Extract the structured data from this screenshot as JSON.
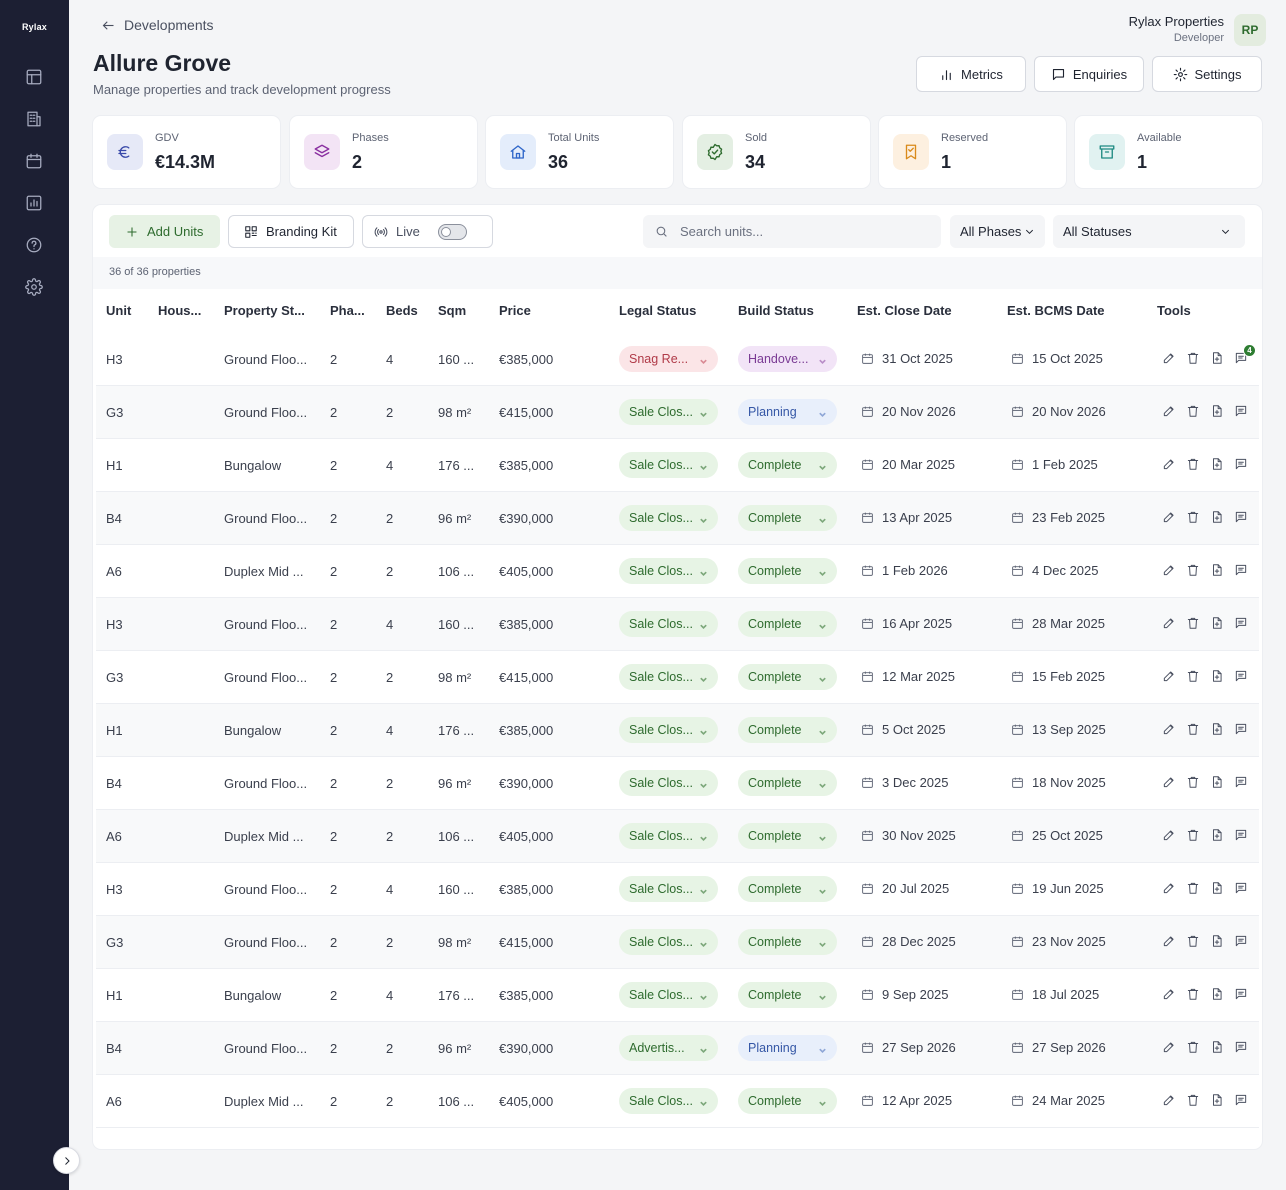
{
  "app": {
    "logo": "Rylax"
  },
  "sidebar": {
    "items": [
      {
        "name": "dashboard",
        "icon": "layout-icon"
      },
      {
        "name": "developments",
        "icon": "building-icon"
      },
      {
        "name": "calendar",
        "icon": "calendar-icon"
      },
      {
        "name": "reports",
        "icon": "chart-icon"
      },
      {
        "name": "help",
        "icon": "help-icon"
      },
      {
        "name": "settings",
        "icon": "gear-icon"
      }
    ]
  },
  "header": {
    "back_label": "Developments",
    "title": "Allure Grove",
    "subtitle": "Manage properties and track development progress",
    "user_name": "Rylax Properties",
    "user_role": "Developer",
    "avatar_initials": "RP",
    "buttons": {
      "metrics": "Metrics",
      "enquiries": "Enquiries",
      "settings": "Settings"
    }
  },
  "stats": [
    {
      "label": "GDV",
      "value": "€14.3M",
      "icon": "euro-icon",
      "bg": "#e6e9f7",
      "color": "#3848a8"
    },
    {
      "label": "Phases",
      "value": "2",
      "icon": "layers-icon",
      "bg": "#f3e4f5",
      "color": "#8a2fa0"
    },
    {
      "label": "Total Units",
      "value": "36",
      "icon": "home-icon",
      "bg": "#e4edfb",
      "color": "#2f66c9"
    },
    {
      "label": "Sold",
      "value": "34",
      "icon": "check-circle-icon",
      "bg": "#e4efe3",
      "color": "#2e6b2e"
    },
    {
      "label": "Reserved",
      "value": "1",
      "icon": "bookmark-icon",
      "bg": "#fdf0e0",
      "color": "#d98a1a"
    },
    {
      "label": "Available",
      "value": "1",
      "icon": "archive-icon",
      "bg": "#e1f2f1",
      "color": "#1f8a82"
    }
  ],
  "toolbar": {
    "add_units": "Add Units",
    "branding_kit": "Branding Kit",
    "live": "Live",
    "search_placeholder": "Search units...",
    "phases_select": "All Phases",
    "status_select": "All Statuses"
  },
  "count_text": "36 of 36 properties",
  "table": {
    "headers": [
      "Unit",
      "Hous...",
      "Property St...",
      "Pha...",
      "Beds",
      "Sqm",
      "Price",
      "Legal Status",
      "Build Status",
      "Est. Close Date",
      "Est. BCMS Date",
      "Tools"
    ],
    "rows": [
      {
        "unit": "H3",
        "house": "",
        "type": "Ground Floo...",
        "phase": "2",
        "beds": "4",
        "sqm": "160 ...",
        "price": "€385,000",
        "legal": "Snag Re...",
        "legal_color": "red",
        "build": "Handove...",
        "build_color": "purple",
        "close": "31 Oct 2025",
        "bcms": "15 Oct 2025",
        "messages": "4"
      },
      {
        "unit": "G3",
        "house": "",
        "type": "Ground Floo...",
        "phase": "2",
        "beds": "2",
        "sqm": "98 m²",
        "price": "€415,000",
        "legal": "Sale Clos...",
        "legal_color": "green",
        "build": "Planning",
        "build_color": "blue",
        "close": "20 Nov 2026",
        "bcms": "20 Nov 2026",
        "messages": ""
      },
      {
        "unit": "H1",
        "house": "",
        "type": "Bungalow",
        "phase": "2",
        "beds": "4",
        "sqm": "176 ...",
        "price": "€385,000",
        "legal": "Sale Clos...",
        "legal_color": "green",
        "build": "Complete",
        "build_color": "green",
        "close": "20 Mar 2025",
        "bcms": "1 Feb 2025",
        "messages": ""
      },
      {
        "unit": "B4",
        "house": "",
        "type": "Ground Floo...",
        "phase": "2",
        "beds": "2",
        "sqm": "96 m²",
        "price": "€390,000",
        "legal": "Sale Clos...",
        "legal_color": "green",
        "build": "Complete",
        "build_color": "green",
        "close": "13 Apr 2025",
        "bcms": "23 Feb 2025",
        "messages": ""
      },
      {
        "unit": "A6",
        "house": "",
        "type": "Duplex Mid ...",
        "phase": "2",
        "beds": "2",
        "sqm": "106 ...",
        "price": "€405,000",
        "legal": "Sale Clos...",
        "legal_color": "green",
        "build": "Complete",
        "build_color": "green",
        "close": "1 Feb 2026",
        "bcms": "4 Dec 2025",
        "messages": ""
      },
      {
        "unit": "H3",
        "house": "",
        "type": "Ground Floo...",
        "phase": "2",
        "beds": "4",
        "sqm": "160 ...",
        "price": "€385,000",
        "legal": "Sale Clos...",
        "legal_color": "green",
        "build": "Complete",
        "build_color": "green",
        "close": "16 Apr 2025",
        "bcms": "28 Mar 2025",
        "messages": ""
      },
      {
        "unit": "G3",
        "house": "",
        "type": "Ground Floo...",
        "phase": "2",
        "beds": "2",
        "sqm": "98 m²",
        "price": "€415,000",
        "legal": "Sale Clos...",
        "legal_color": "green",
        "build": "Complete",
        "build_color": "green",
        "close": "12 Mar 2025",
        "bcms": "15 Feb 2025",
        "messages": ""
      },
      {
        "unit": "H1",
        "house": "",
        "type": "Bungalow",
        "phase": "2",
        "beds": "4",
        "sqm": "176 ...",
        "price": "€385,000",
        "legal": "Sale Clos...",
        "legal_color": "green",
        "build": "Complete",
        "build_color": "green",
        "close": "5 Oct 2025",
        "bcms": "13 Sep 2025",
        "messages": ""
      },
      {
        "unit": "B4",
        "house": "",
        "type": "Ground Floo...",
        "phase": "2",
        "beds": "2",
        "sqm": "96 m²",
        "price": "€390,000",
        "legal": "Sale Clos...",
        "legal_color": "green",
        "build": "Complete",
        "build_color": "green",
        "close": "3 Dec 2025",
        "bcms": "18 Nov 2025",
        "messages": ""
      },
      {
        "unit": "A6",
        "house": "",
        "type": "Duplex Mid ...",
        "phase": "2",
        "beds": "2",
        "sqm": "106 ...",
        "price": "€405,000",
        "legal": "Sale Clos...",
        "legal_color": "green",
        "build": "Complete",
        "build_color": "green",
        "close": "30 Nov 2025",
        "bcms": "25 Oct 2025",
        "messages": ""
      },
      {
        "unit": "H3",
        "house": "",
        "type": "Ground Floo...",
        "phase": "2",
        "beds": "4",
        "sqm": "160 ...",
        "price": "€385,000",
        "legal": "Sale Clos...",
        "legal_color": "green",
        "build": "Complete",
        "build_color": "green",
        "close": "20 Jul 2025",
        "bcms": "19 Jun 2025",
        "messages": ""
      },
      {
        "unit": "G3",
        "house": "",
        "type": "Ground Floo...",
        "phase": "2",
        "beds": "2",
        "sqm": "98 m²",
        "price": "€415,000",
        "legal": "Sale Clos...",
        "legal_color": "green",
        "build": "Complete",
        "build_color": "green",
        "close": "28 Dec 2025",
        "bcms": "23 Nov 2025",
        "messages": ""
      },
      {
        "unit": "H1",
        "house": "",
        "type": "Bungalow",
        "phase": "2",
        "beds": "4",
        "sqm": "176 ...",
        "price": "€385,000",
        "legal": "Sale Clos...",
        "legal_color": "green",
        "build": "Complete",
        "build_color": "green",
        "close": "9 Sep 2025",
        "bcms": "18 Jul 2025",
        "messages": ""
      },
      {
        "unit": "B4",
        "house": "",
        "type": "Ground Floo...",
        "phase": "2",
        "beds": "2",
        "sqm": "96 m²",
        "price": "€390,000",
        "legal": "Advertis...",
        "legal_color": "green",
        "build": "Planning",
        "build_color": "blue",
        "close": "27 Sep 2026",
        "bcms": "27 Sep 2026",
        "messages": ""
      },
      {
        "unit": "A6",
        "house": "",
        "type": "Duplex Mid ...",
        "phase": "2",
        "beds": "2",
        "sqm": "106 ...",
        "price": "€405,000",
        "legal": "Sale Clos...",
        "legal_color": "green",
        "build": "Complete",
        "build_color": "green",
        "close": "12 Apr 2025",
        "bcms": "24 Mar 2025",
        "messages": ""
      }
    ]
  }
}
